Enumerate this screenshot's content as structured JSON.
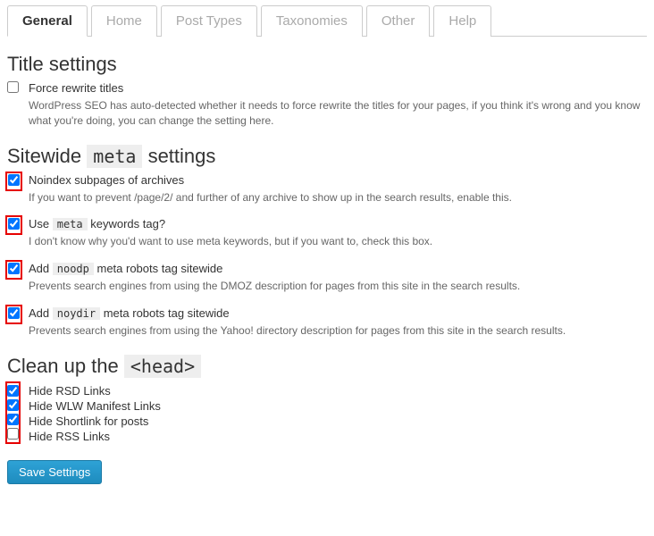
{
  "tabs": [
    "General",
    "Home",
    "Post Types",
    "Taxonomies",
    "Other",
    "Help"
  ],
  "section1": {
    "title": "Title settings",
    "cb1_label": "Force rewrite titles",
    "cb1_desc": "WordPress SEO has auto-detected whether it needs to force rewrite the titles for your pages, if you think it's wrong and you know what you're doing, you can change the setting here."
  },
  "section2": {
    "title_pre": "Sitewide ",
    "title_code": "meta",
    "title_post": " settings",
    "i1_label": "Noindex subpages of archives",
    "i1_desc": "If you want to prevent /page/2/ and further of any archive to show up in the search results, enable this.",
    "i2_pre": "Use ",
    "i2_code": "meta",
    "i2_post": " keywords tag?",
    "i2_desc": "I don't know why you'd want to use meta keywords, but if you want to, check this box.",
    "i3_pre": "Add ",
    "i3_code": "noodp",
    "i3_post": " meta robots tag sitewide",
    "i3_desc": "Prevents search engines from using the DMOZ description for pages from this site in the search results.",
    "i4_pre": "Add ",
    "i4_code": "noydir",
    "i4_post": " meta robots tag sitewide",
    "i4_desc": "Prevents search engines from using the Yahoo! directory description for pages from this site in the search results."
  },
  "section3": {
    "title_pre": "Clean up the ",
    "title_code": "<head>",
    "c1": "Hide RSD Links",
    "c2": "Hide WLW Manifest Links",
    "c3": "Hide Shortlink for posts",
    "c4": "Hide RSS Links"
  },
  "save": "Save Settings"
}
